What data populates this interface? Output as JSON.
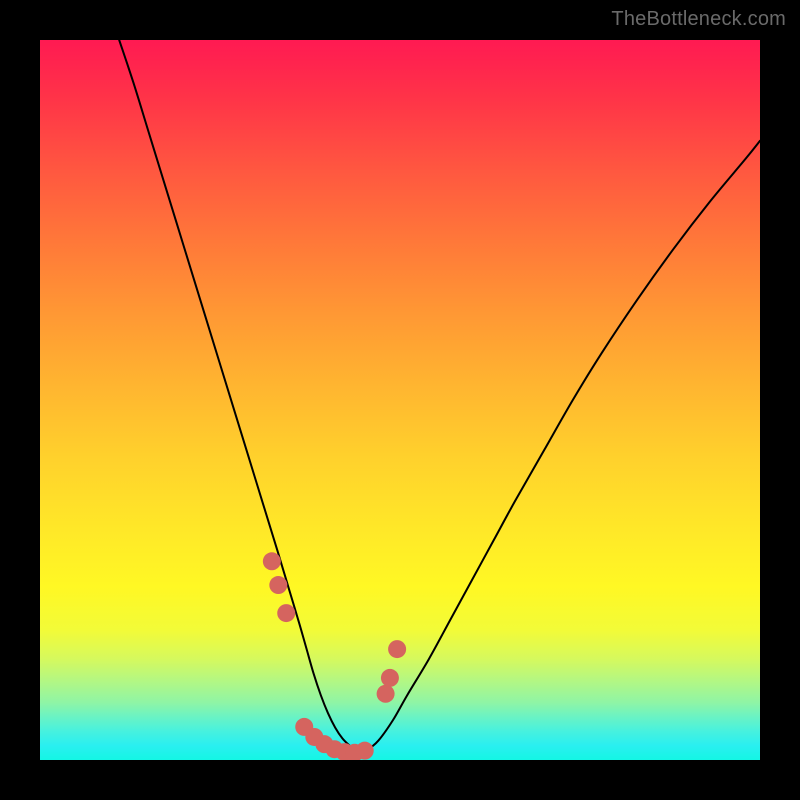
{
  "watermark": "TheBottleneck.com",
  "chart_data": {
    "type": "line",
    "title": "",
    "xlabel": "",
    "ylabel": "",
    "xlim": [
      0,
      100
    ],
    "ylim": [
      0,
      100
    ],
    "series": [
      {
        "name": "curve",
        "x": [
          11,
          13,
          15,
          17,
          19,
          21,
          23,
          25,
          27,
          29,
          31,
          33,
          34.5,
          36,
          37,
          38,
          39,
          40,
          41,
          42,
          43,
          44,
          45.5,
          47,
          49,
          51,
          54,
          57,
          60,
          63,
          66,
          70,
          74,
          78,
          83,
          88,
          93,
          98,
          100
        ],
        "y": [
          100,
          94,
          87.5,
          81,
          74.5,
          68,
          61.5,
          55,
          48.5,
          42,
          35.5,
          29,
          24,
          19,
          15.5,
          12,
          9,
          6.5,
          4.5,
          3,
          2,
          1.2,
          1.5,
          2.7,
          5.5,
          9,
          14,
          19.5,
          25,
          30.5,
          36,
          43,
          50,
          56.5,
          64,
          71,
          77.5,
          83.5,
          86
        ]
      }
    ],
    "markers": [
      {
        "x": 32.2,
        "y": 27.6
      },
      {
        "x": 33.1,
        "y": 24.3
      },
      {
        "x": 34.2,
        "y": 20.4
      },
      {
        "x": 36.7,
        "y": 4.6
      },
      {
        "x": 38.1,
        "y": 3.2
      },
      {
        "x": 39.5,
        "y": 2.2
      },
      {
        "x": 40.9,
        "y": 1.5
      },
      {
        "x": 42.3,
        "y": 1.1
      },
      {
        "x": 43.7,
        "y": 1.0
      },
      {
        "x": 45.1,
        "y": 1.3
      },
      {
        "x": 48.0,
        "y": 9.2
      },
      {
        "x": 48.6,
        "y": 11.4
      },
      {
        "x": 49.6,
        "y": 15.4
      }
    ],
    "colors": {
      "curve": "#000000",
      "marker": "#d5645f"
    }
  }
}
